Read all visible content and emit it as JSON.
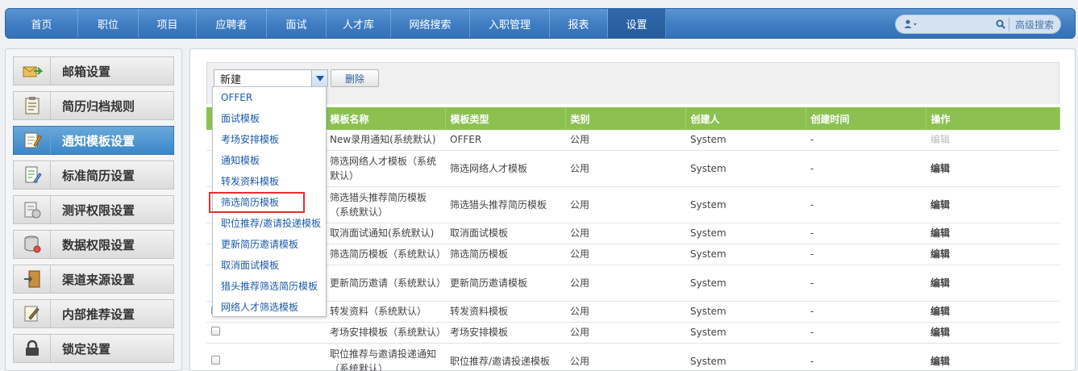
{
  "nav": {
    "items": [
      "首页",
      "职位",
      "项目",
      "应聘者",
      "面试",
      "人才库",
      "网络搜索",
      "入职管理",
      "报表",
      "设置"
    ],
    "active_index": 9,
    "advanced_search": "高级搜索"
  },
  "sidebar": {
    "items": [
      {
        "label": "邮箱设置",
        "icon": "mailbox-icon"
      },
      {
        "label": "简历归档规则",
        "icon": "clipboard-icon"
      },
      {
        "label": "通知模板设置",
        "icon": "notepad-pencil-icon"
      },
      {
        "label": "标准简历设置",
        "icon": "document-edit-icon"
      },
      {
        "label": "测评权限设置",
        "icon": "test-document-icon"
      },
      {
        "label": "数据权限设置",
        "icon": "database-icon"
      },
      {
        "label": "渠道来源设置",
        "icon": "door-exit-icon"
      },
      {
        "label": "内部推荐设置",
        "icon": "document-pen-icon"
      },
      {
        "label": "锁定设置",
        "icon": "lock-icon"
      }
    ],
    "active_index": 2
  },
  "toolbar": {
    "select_value": "新建",
    "delete_label": "删除"
  },
  "dropdown": {
    "options": [
      "OFFER",
      "面试模板",
      "考场安排模板",
      "通知模板",
      "转发资料模板",
      "筛选简历模板",
      "职位推荐/邀请投递模板",
      "更新简历邀请模板",
      "取消面试模板",
      "猎头推荐筛选简历模板",
      "网络人才筛选模板"
    ],
    "highlighted_index": 5
  },
  "table": {
    "columns": [
      "",
      "模板名称",
      "模板类型",
      "类别",
      "创建人",
      "创建时间",
      "操作"
    ],
    "rows": [
      {
        "name": "New录用通知(系统默认)",
        "type": "OFFER",
        "category": "公用",
        "creator": "System",
        "created": "-",
        "action": "编辑",
        "action_disabled": true
      },
      {
        "name": "筛选网络人才模板（系统默认）",
        "type": "筛选网络人才模板",
        "category": "公用",
        "creator": "System",
        "created": "-",
        "action": "编辑"
      },
      {
        "name": "筛选猎头推荐简历模板（系统默认）",
        "type": "筛选猎头推荐简历模板",
        "category": "公用",
        "creator": "System",
        "created": "-",
        "action": "编辑"
      },
      {
        "name": "取消面试通知(系统默认)",
        "type": "取消面试模板",
        "category": "公用",
        "creator": "System",
        "created": "-",
        "action": "编辑"
      },
      {
        "name": "筛选简历模板（系统默认）",
        "type": "筛选简历模板",
        "category": "公用",
        "creator": "System",
        "created": "-",
        "action": "编辑"
      },
      {
        "name": "更新简历邀请（系统默认）",
        "type": "更新简历邀请模板",
        "category": "公用",
        "creator": "System",
        "created": "-",
        "action": "编辑"
      },
      {
        "name": "转发资料（系统默认）",
        "type": "转发资料模板",
        "category": "公用",
        "creator": "System",
        "created": "-",
        "action": "编辑"
      },
      {
        "name": "考场安排模板（系统默认）",
        "type": "考场安排模板",
        "category": "公用",
        "creator": "System",
        "created": "-",
        "action": "编辑"
      },
      {
        "name": "职位推荐与邀请投递通知（系统默认）",
        "type": "职位推荐/邀请投递模板",
        "category": "公用",
        "creator": "System",
        "created": "-",
        "action": "编辑"
      }
    ]
  }
}
